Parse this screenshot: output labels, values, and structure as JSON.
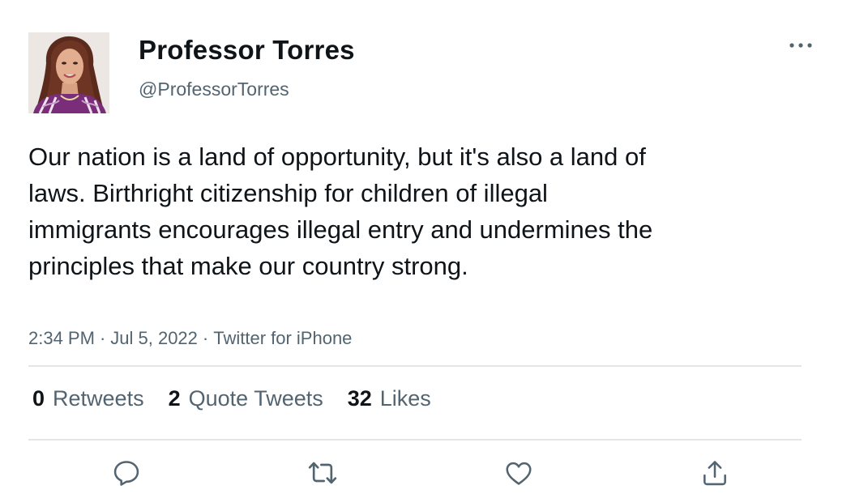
{
  "author": {
    "display_name": "Professor Torres",
    "handle": "@ProfessorTorres",
    "avatar_icon": "profile-photo"
  },
  "tweet": {
    "text": "Our nation is a land of opportunity, but it's also a land of laws. Birthright citizenship for children of illegal immigrants encourages illegal entry and undermines the principles that make our country strong.",
    "time": "2:34 PM",
    "date": "Jul 5, 2022",
    "source": "Twitter for iPhone",
    "separator": "·"
  },
  "stats": {
    "retweets": {
      "count": "0",
      "label": "Retweets"
    },
    "quote_tweets": {
      "count": "2",
      "label": "Quote Tweets"
    },
    "likes": {
      "count": "32",
      "label": "Likes"
    }
  },
  "actions": [
    "reply-icon",
    "retweet-icon",
    "like-icon",
    "share-icon"
  ],
  "colors": {
    "text_primary": "#0f1419",
    "text_secondary": "#536471",
    "divider": "#e3e5e8",
    "icon": "#536471"
  }
}
